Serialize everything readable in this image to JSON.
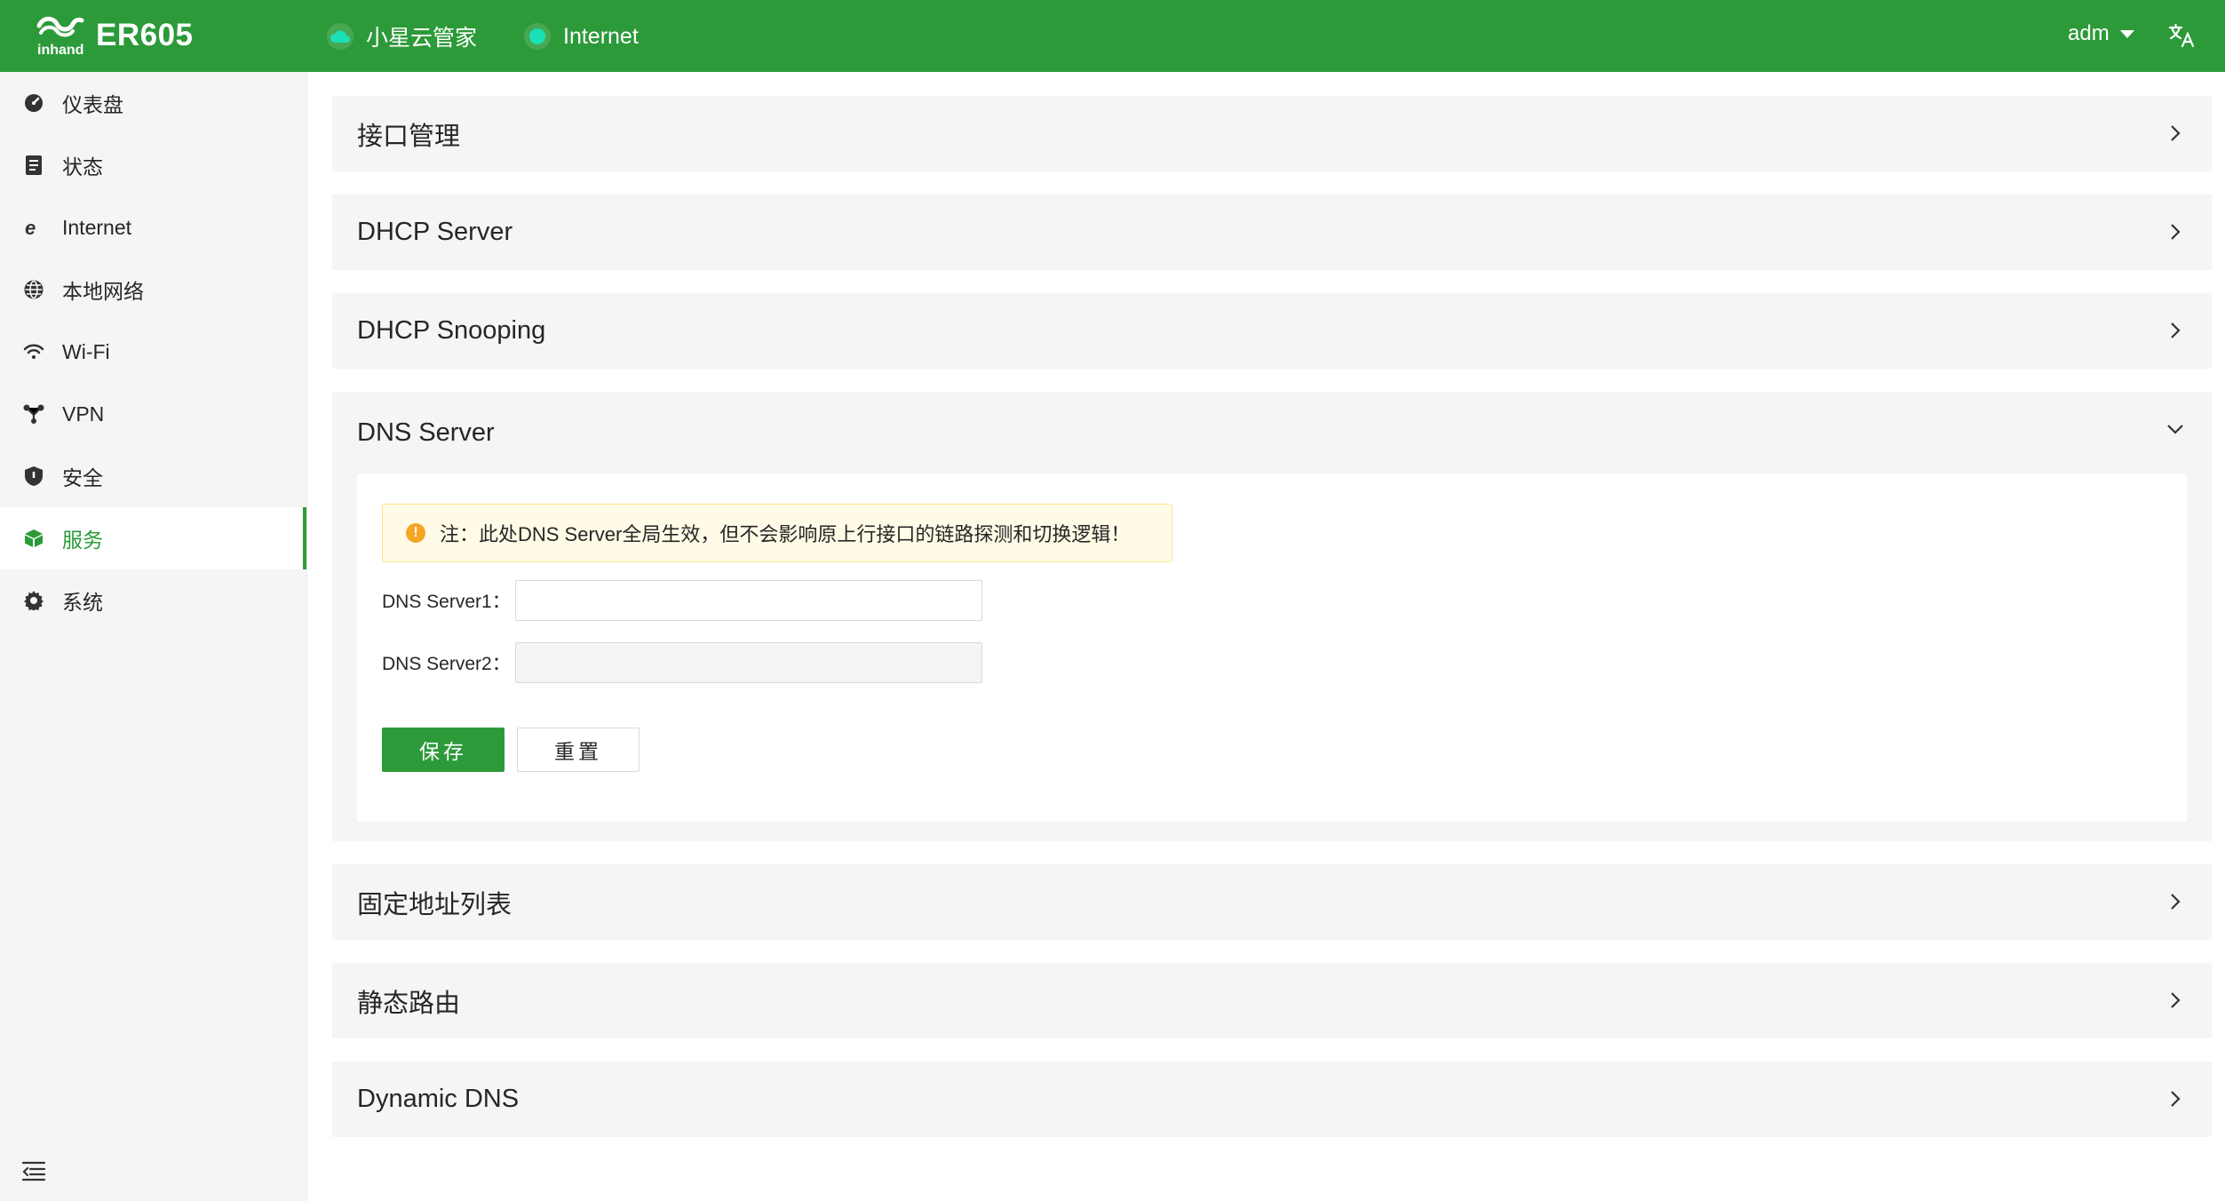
{
  "app": {
    "brand_text": "inhand",
    "model": "ER605",
    "cloud_label": "小星云管家",
    "internet_label": "Internet",
    "user": "adm",
    "colors": {
      "primary": "#2d9a3a",
      "status_dot": "#19e0b5",
      "warning": "#f5a623"
    }
  },
  "sidebar": {
    "items": [
      {
        "label": "仪表盘",
        "icon": "dashboard-icon"
      },
      {
        "label": "状态",
        "icon": "status-icon"
      },
      {
        "label": "Internet",
        "icon": "internet-icon"
      },
      {
        "label": "本地网络",
        "icon": "globe-icon"
      },
      {
        "label": "Wi-Fi",
        "icon": "wifi-icon"
      },
      {
        "label": "VPN",
        "icon": "vpn-icon"
      },
      {
        "label": "安全",
        "icon": "shield-icon"
      },
      {
        "label": "服务",
        "icon": "cube-icon",
        "active": true
      },
      {
        "label": "系统",
        "icon": "gear-icon"
      }
    ]
  },
  "panels": {
    "interface": "接口管理",
    "dhcp_server": "DHCP Server",
    "dhcp_snooping": "DHCP Snooping",
    "dns_server": "DNS Server",
    "fixed_address": "固定地址列表",
    "static_route": "静态路由",
    "dynamic_dns": "Dynamic DNS"
  },
  "dns": {
    "notice": "注：此处DNS Server全局生效，但不会影响原上行接口的链路探测和切换逻辑！",
    "server1_label": "DNS Server1：",
    "server1_value": "",
    "server2_label": "DNS Server2：",
    "server2_value": "",
    "save_label": "保存",
    "reset_label": "重置"
  }
}
